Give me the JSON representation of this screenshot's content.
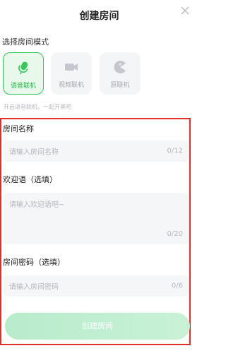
{
  "header": {
    "title": "创建房间"
  },
  "mode_section": {
    "label": "选择房间模式",
    "modes": [
      {
        "label": "语音联机",
        "icon": "microphone-icon",
        "selected": true
      },
      {
        "label": "视频联机",
        "icon": "video-camera-icon",
        "selected": false
      },
      {
        "label": "原联机",
        "icon": "pacman-icon",
        "selected": false
      }
    ],
    "hint": "开启语音联机，一起开黑吧"
  },
  "form": {
    "room_name": {
      "label": "房间名称",
      "placeholder": "请输入房间名称",
      "count": "0/12"
    },
    "welcome": {
      "label": "欢迎语（选填）",
      "placeholder": "请输入欢迎语吧~",
      "count": "0/20"
    },
    "password": {
      "label": "房间密码（选填）",
      "placeholder": "请输入房间密码",
      "count": "0/6"
    }
  },
  "create_button": {
    "label": "创建房间"
  },
  "colors": {
    "accent": "#38c75b",
    "highlight_border": "#e22d2d",
    "button": "#c9f1d6"
  }
}
